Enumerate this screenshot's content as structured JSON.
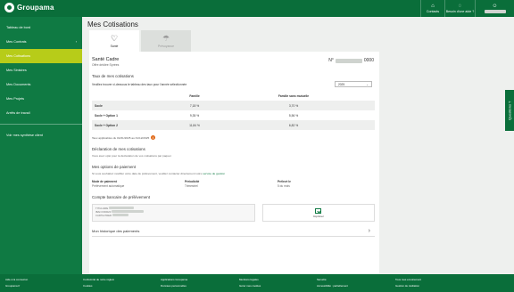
{
  "topbar": {
    "brand": "Groupama",
    "contacts": "Contacts",
    "help": "Besoin d'une aide ?",
    "user": "Ma... "
  },
  "sidebar": {
    "items": [
      {
        "label": "Tableau de bord"
      },
      {
        "label": "Mes Contrats"
      },
      {
        "label": "Mes Cotisations"
      },
      {
        "label": "Mes Sinistres"
      },
      {
        "label": "Mes Documents"
      },
      {
        "label": "Mes Projets"
      },
      {
        "label": "Arrêts de travail"
      }
    ],
    "footer_item": "Voir mes synthèse client"
  },
  "main": {
    "title": "Mes Cotisations",
    "tabs": [
      {
        "label": "Santé",
        "icon": "heart-icon"
      },
      {
        "label": "Prévoyance",
        "icon": "umbrella-icon"
      }
    ],
    "card": {
      "product": "Santé Cadre",
      "offer": "Offre dédiée Sprées",
      "number_prefix": "N°",
      "number_suffix": "0000",
      "taux_title": "Taux de mes cotisations",
      "taux_question": "Veuillez trouver ci-dessous le tableau des taux pour l'année sélectionnée",
      "year": "2025",
      "table": {
        "headers": [
          "",
          "Famille",
          "Famille sans mutuelle"
        ],
        "rows": [
          [
            "Socle",
            "7,18 %",
            "3,70 %"
          ],
          [
            "Socle + Option 1",
            "9,35 %",
            "5,56 %"
          ],
          [
            "Socle + Option 2",
            "11,84 %",
            "6,82 %"
          ]
        ]
      },
      "note": "Taux applicables du 01/01/2025 au 31/12/2025",
      "declaration_title": "Déclaration de mes cotisations",
      "declaration_desc": "Vous avez opté pour la déclaration de vos cotisations par paquet",
      "payment_title": "Mes options de paiement",
      "payment_desc": "Si vous souhaitez modifier votre date de prélèvement, veuillez contacter directement votre",
      "payment_link": "service de gestion",
      "payment_cols": [
        {
          "label": "Mode de paiement",
          "value": "Prélèvement automatique"
        },
        {
          "label": "Périodicité",
          "value": "Trimestriel"
        },
        {
          "label": "Prélevé le",
          "value": "5 du mois"
        }
      ],
      "bank_title": "Compte bancaire de prélèvement",
      "iban_lines": [
        "TITULAIRE",
        "IBAN FR0020 ",
        "CARTE PRER"
      ],
      "download_label": "Imprimer",
      "history_label": "Mon historique des paiements"
    }
  },
  "side_tab": "Questions ?",
  "footer": {
    "cols": [
      [
        "Aide à la connexion",
        "Groupama.fr"
      ],
      [
        "Conformité de notre règlem",
        "Cookies"
      ],
      [
        "Applications Groupama",
        "Données personnelles"
      ],
      [
        "Mentions légales",
        "Gérer mes cookies"
      ],
      [
        "Sécurité",
        "Accessibilité : partiellement"
      ],
      [
        "Tous mes envoirement",
        "Gestion de résiliation"
      ]
    ]
  },
  "colors": {
    "brand_green": "#0a6e3a",
    "sidebar_green": "#0f7a43",
    "active_item": "#b7cc19",
    "alert_orange": "#e06a1a"
  }
}
